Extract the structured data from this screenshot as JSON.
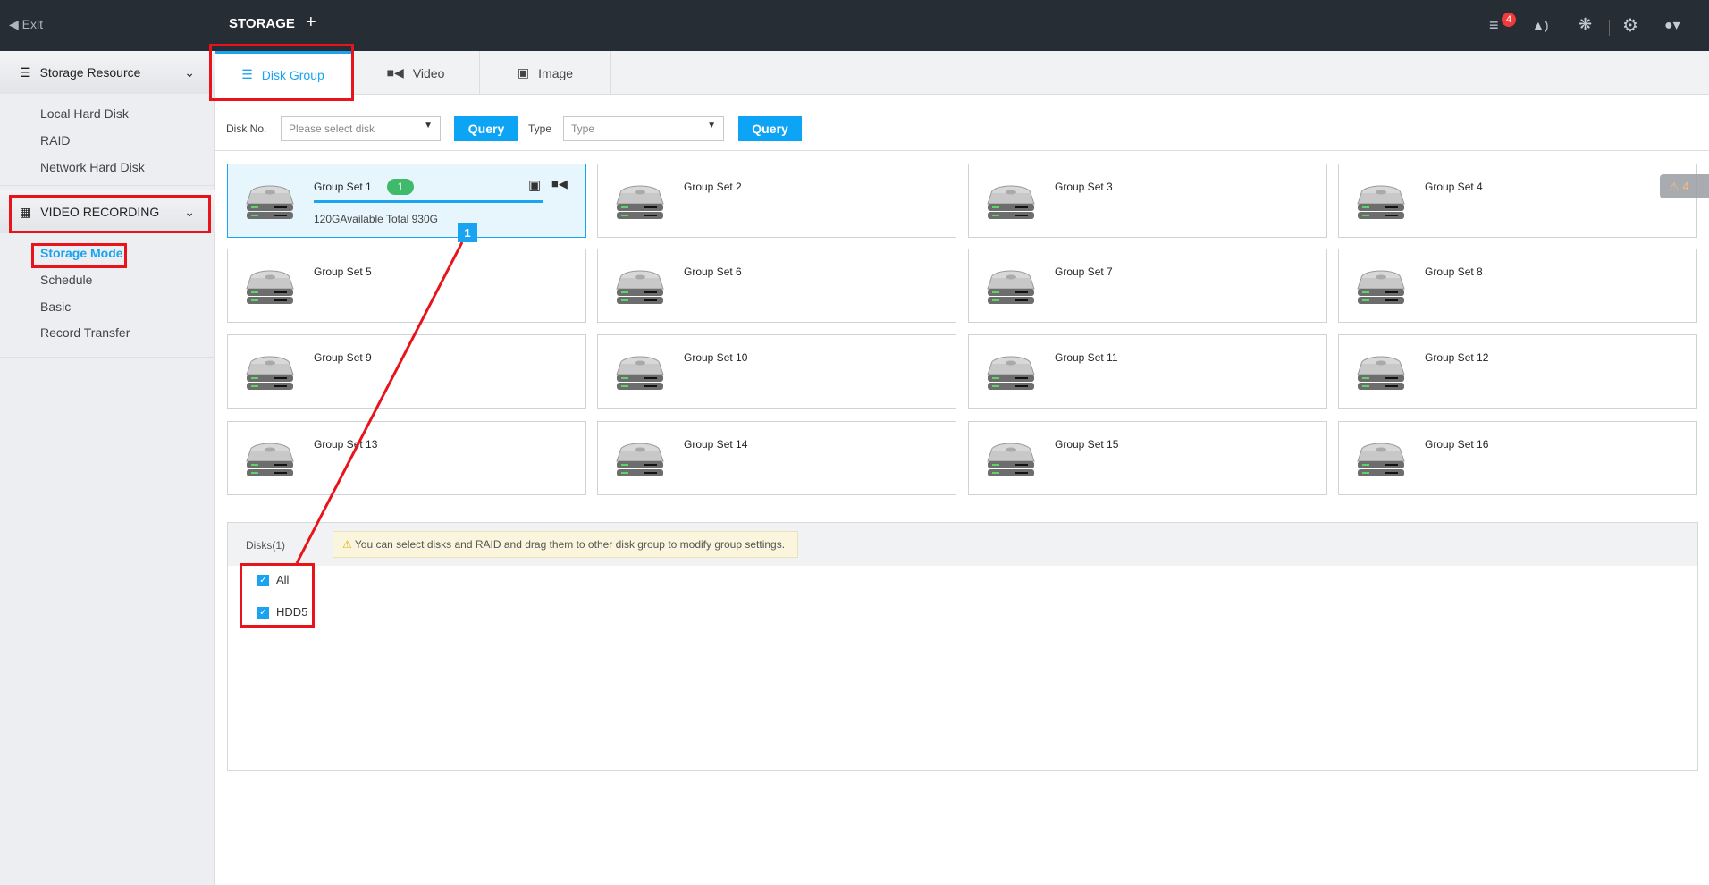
{
  "topbar": {
    "exit": "Exit",
    "title": "STORAGE",
    "add": "+",
    "notification_count": "4",
    "icons": [
      "list-icon",
      "alarm-icon",
      "aperture-icon",
      "gear-icon",
      "user-icon"
    ]
  },
  "sidebar": {
    "sections": [
      {
        "label": "Storage Resource",
        "items": [
          "Local Hard Disk",
          "RAID",
          "Network Hard Disk"
        ]
      },
      {
        "label": "VIDEO RECORDING",
        "items": [
          "Storage Mode",
          "Schedule",
          "Basic",
          "Record Transfer"
        ],
        "active": "Storage Mode"
      }
    ]
  },
  "tabs": [
    {
      "label": "Disk Group",
      "active": true
    },
    {
      "label": "Video"
    },
    {
      "label": "Image"
    }
  ],
  "query": {
    "disk_label": "Disk No.",
    "disk_placeholder": "Please select disk",
    "query1": "Query",
    "type_label": "Type",
    "type_placeholder": "Type",
    "query2": "Query"
  },
  "groups": [
    "Group Set 1",
    "Group Set 2",
    "Group Set 3",
    "Group Set 4",
    "Group Set 5",
    "Group Set 6",
    "Group Set 7",
    "Group Set 8",
    "Group Set 9",
    "Group Set 10",
    "Group Set 11",
    "Group Set 12",
    "Group Set 13",
    "Group Set 14",
    "Group Set 15",
    "Group Set 16"
  ],
  "group1": {
    "badge": "1",
    "capacity": "120GAvailable Total 930G",
    "usage_percent": 87
  },
  "alert_badge": "4",
  "annotation_marker": "1",
  "disks": {
    "title": "Disks(1)",
    "hint": "You can select disks and RAID and drag them to other disk group to modify group settings.",
    "items": [
      {
        "label": "All",
        "checked": true
      },
      {
        "label": "HDD5",
        "checked": true
      }
    ]
  },
  "colors": {
    "accent": "#1aa3f0",
    "annotation": "#e8141c",
    "badge_green": "#3fb96a"
  }
}
